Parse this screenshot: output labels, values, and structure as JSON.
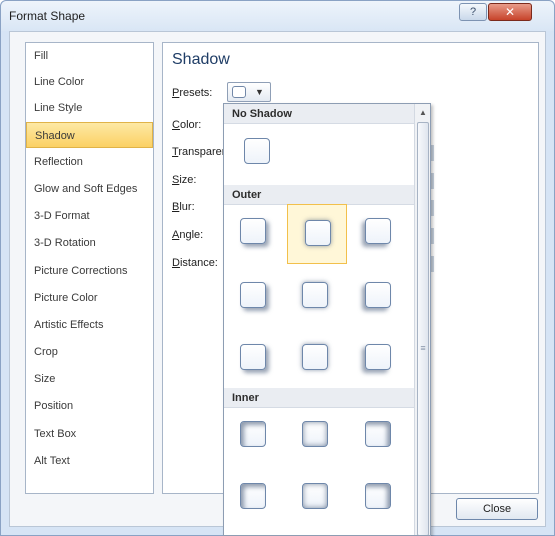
{
  "window": {
    "title": "Format Shape",
    "help_label": "?",
    "close_label": "✕"
  },
  "nav": {
    "items": [
      {
        "label": "Fill"
      },
      {
        "label": "Line Color"
      },
      {
        "label": "Line Style"
      },
      {
        "label": "Shadow"
      },
      {
        "label": "Reflection"
      },
      {
        "label": "Glow and Soft Edges"
      },
      {
        "label": "3-D Format"
      },
      {
        "label": "3-D Rotation"
      },
      {
        "label": "Picture Corrections"
      },
      {
        "label": "Picture Color"
      },
      {
        "label": "Artistic Effects"
      },
      {
        "label": "Crop"
      },
      {
        "label": "Size"
      },
      {
        "label": "Position"
      },
      {
        "label": "Text Box"
      },
      {
        "label": "Alt Text"
      }
    ],
    "selected": "Shadow"
  },
  "panel": {
    "title": "Shadow",
    "fields": {
      "presets": {
        "accel": "P",
        "rest": "resets:"
      },
      "color": {
        "accel": "C",
        "rest": "olor:"
      },
      "transparency": {
        "accel": "T",
        "rest": "ransparen"
      },
      "size": {
        "accel": "S",
        "rest": "ize:"
      },
      "blur": {
        "accel": "B",
        "rest": "lur:"
      },
      "angle": {
        "accel": "A",
        "rest": "ngle:"
      },
      "distance": {
        "accel": "D",
        "rest": "istance:"
      }
    }
  },
  "presets_gallery": {
    "sections": {
      "no_shadow": "No Shadow",
      "outer": "Outer",
      "inner": "Inner"
    },
    "scroll_up_icon": "▲",
    "scroll_grip": "≡"
  },
  "footer": {
    "close_label": "Close"
  },
  "icons": {
    "dropdown": "chevron-down-icon",
    "help": "help-icon",
    "close": "close-icon"
  },
  "colors": {
    "selected_fill": "#fbd164",
    "hover_border": "#f2c04b",
    "title_blue": "#1f3d66",
    "close_red": "#c7432a"
  }
}
